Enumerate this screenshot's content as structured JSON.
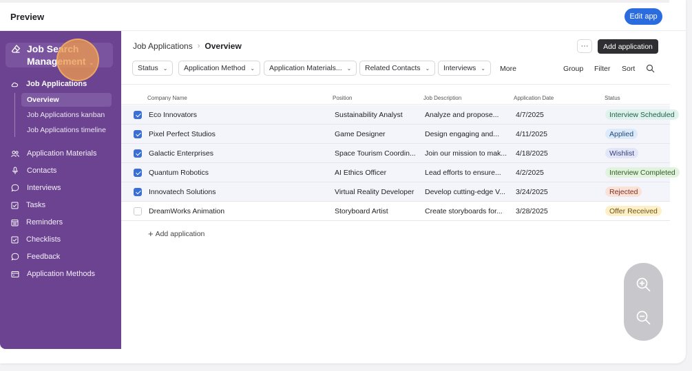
{
  "preview": {
    "title": "Preview",
    "edit_label": "Edit app"
  },
  "sidebar": {
    "app_name": "Job Search Management",
    "chevron": "⌄",
    "group": {
      "label": "Job Applications",
      "icon": "cloud-icon"
    },
    "sub_items": [
      {
        "label": "Overview",
        "active": true
      },
      {
        "label": "Job Applications kanban",
        "active": false
      },
      {
        "label": "Job Applications timeline",
        "active": false
      }
    ],
    "items": [
      {
        "label": "Application Materials",
        "icon": "people-icon"
      },
      {
        "label": "Contacts",
        "icon": "mic-icon"
      },
      {
        "label": "Interviews",
        "icon": "chat-icon"
      },
      {
        "label": "Tasks",
        "icon": "checkbox-icon"
      },
      {
        "label": "Reminders",
        "icon": "calendar-icon"
      },
      {
        "label": "Checklists",
        "icon": "checkbox-icon"
      },
      {
        "label": "Feedback",
        "icon": "chat-icon"
      },
      {
        "label": "Application Methods",
        "icon": "card-icon"
      }
    ]
  },
  "header": {
    "breadcrumb_parent": "Job Applications",
    "breadcrumb_sep": "›",
    "breadcrumb_current": "Overview",
    "more_label": "···",
    "add_label": "Add application"
  },
  "filters": {
    "chips": [
      "Status",
      "Application Method",
      "Application Materials...",
      "Related Contacts",
      "Interviews"
    ],
    "more": "More",
    "group": "Group",
    "filter": "Filter",
    "sort": "Sort"
  },
  "table": {
    "columns": [
      "Company Name",
      "Position",
      "Job Description",
      "Application Date",
      "Status"
    ],
    "rows": [
      {
        "checked": true,
        "company": "Eco Innovators",
        "position": "Sustainability Analyst",
        "description": "Analyze and propose...",
        "date": "4/7/2025",
        "status": "Interview Scheduled"
      },
      {
        "checked": true,
        "company": "Pixel Perfect Studios",
        "position": "Game Designer",
        "description": "Design engaging and...",
        "date": "4/11/2025",
        "status": "Applied"
      },
      {
        "checked": true,
        "company": "Galactic Enterprises",
        "position": "Space Tourism Coordin...",
        "description": "Join our mission to mak...",
        "date": "4/18/2025",
        "status": "Wishlist"
      },
      {
        "checked": true,
        "company": "Quantum Robotics",
        "position": "AI Ethics Officer",
        "description": "Lead efforts to ensure...",
        "date": "4/2/2025",
        "status": "Interview Completed"
      },
      {
        "checked": true,
        "company": "Innovatech Solutions",
        "position": "Virtual Reality Developer",
        "description": "Develop cutting-edge V...",
        "date": "3/24/2025",
        "status": "Rejected"
      },
      {
        "checked": false,
        "company": "DreamWorks Animation",
        "position": "Storyboard Artist",
        "description": "Create storyboards for...",
        "date": "3/28/2025",
        "status": "Offer Received"
      }
    ],
    "add_row_label": "Add application"
  },
  "status_colors": {
    "Interview Scheduled": {
      "bg": "#dff3ec",
      "fg": "#1f5e4a"
    },
    "Applied": {
      "bg": "#dcebfa",
      "fg": "#234a77"
    },
    "Wishlist": {
      "bg": "#e2e6f8",
      "fg": "#34407a"
    },
    "Interview Completed": {
      "bg": "#e1f3dc",
      "fg": "#2e5a26"
    },
    "Rejected": {
      "bg": "#fbe1d8",
      "fg": "#7a3220"
    },
    "Offer Received": {
      "bg": "#fdf0c9",
      "fg": "#6b5110"
    }
  },
  "zoom": {
    "in_icon": "zoom-in-icon",
    "out_icon": "zoom-out-icon"
  },
  "colors": {
    "sidebar": "#6b4391",
    "accent": "#2b6be0",
    "checkbox": "#3b6fd4"
  }
}
